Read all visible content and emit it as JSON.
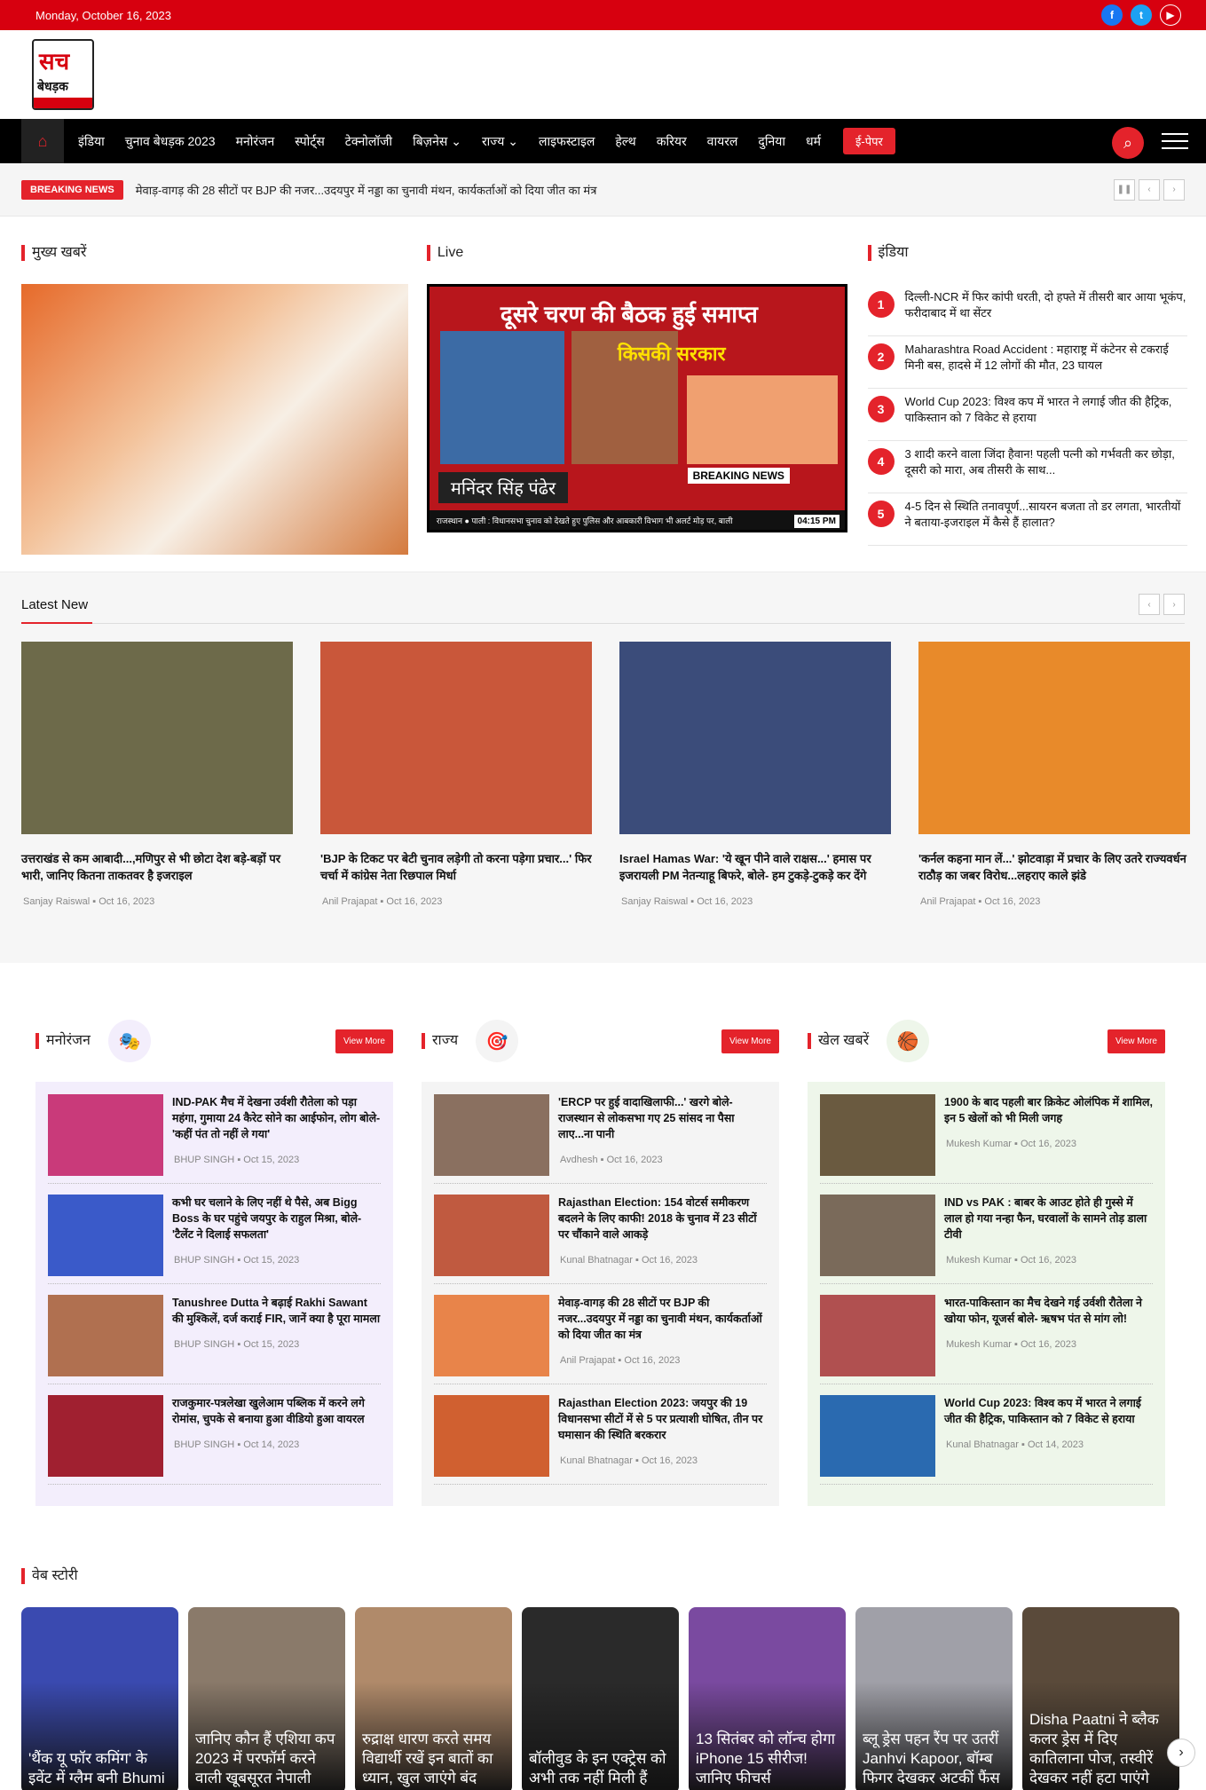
{
  "topbar": {
    "date": "Monday, October 16, 2023",
    "social": [
      "f",
      "t",
      "▶"
    ]
  },
  "logo": {
    "line1": "सच",
    "line2": "बेधड़क"
  },
  "nav": {
    "items": [
      "इंडिया",
      "चुनाव बेधड़क 2023",
      "मनोरंजन",
      "स्पोर्ट्स",
      "टेक्नोलॉजी",
      "बिज़नेस ⌄",
      "राज्य ⌄",
      "लाइफस्टाइल",
      "हेल्थ",
      "करियर",
      "वायरल",
      "दुनिया",
      "धर्म"
    ],
    "epaper": "ई-पेपर"
  },
  "breaking": {
    "label": "BREAKING NEWS",
    "text": "मेवाड़-वागड़ की 28 सीटों पर BJP की नजर...उदयपुर में नड्डा का चुनावी मंथन, कार्यकर्ताओं को दिया जीत का मंत्र"
  },
  "top": {
    "main_title": "मुख्य खबरें",
    "live_title": "Live",
    "live": {
      "headline": "दूसरे चरण की बैठक हुई समाप्त",
      "sarkar": "किसकी सरकार",
      "breaking": "BREAKING NEWS",
      "name": "मनिंदर सिंह पंढेर",
      "ticker": "राजस्थान ● पाली : विधानसभा चुनाव को देखते हुए पुलिस और आबकारी विभाग भी अलर्ट मोड़ पर, बाली",
      "time": "04:15 PM"
    },
    "india_title": "इंडिया",
    "india": [
      {
        "n": "1",
        "t": "दिल्ली-NCR में फिर कांपी धरती, दो हफ्ते में तीसरी बार आया भूकंप, फरीदाबाद में था सेंटर"
      },
      {
        "n": "2",
        "t": "Maharashtra Road Accident : महाराष्ट्र में कंटेनर से टकराई मिनी बस, हादसे में 12 लोगों की मौत, 23 घायल"
      },
      {
        "n": "3",
        "t": "World Cup 2023: विश्व कप में भारत ने लगाई जीत की हैट्रिक, पाकिस्तान को 7 विकेट से हराया"
      },
      {
        "n": "4",
        "t": "3 शादी करने वाला जिंदा हैवान! पहली पत्नी को गर्भवती कर छोड़ा, दूसरी को मारा, अब तीसरी के साथ..."
      },
      {
        "n": "5",
        "t": "4-5 दिन से स्थिति तनावपूर्ण...सायरन बजता तो डर लगता, भारतीयों ने बताया-इजराइल में कैसे हैं हालात?"
      }
    ]
  },
  "latest": {
    "title": "Latest New",
    "cards": [
      {
        "t": "उत्तराखंड से कम आबादी...,मणिपुर से भी छोटा देश बड़े-बड़ों पर भारी, जानिए कितना ताकतवर है इजराइल",
        "author": "Sanjay Raiswal",
        "date": "Oct 16, 2023",
        "color": "#6d6a4a"
      },
      {
        "t": "'BJP के टिकट पर बेटी चुनाव लड़ेगी तो करना पड़ेगा प्रचार...' फिर चर्चा में कांग्रेस नेता रिछपाल मिर्धा",
        "author": "Anil Prajapat",
        "date": "Oct 16, 2023",
        "color": "#c9573a"
      },
      {
        "t": "Israel Hamas War: 'ये खून पीने वाले राक्षस...' हमास पर इजरायली PM नेतन्याहू बिफरे, बोले- हम टुकड़े-टुकड़े कर देंगे",
        "author": "Sanjay Raiswal",
        "date": "Oct 16, 2023",
        "color": "#3b4c7a"
      },
      {
        "t": "'कर्नल कहना मान लें...' झोटवाड़ा में प्रचार के लिए उतरे राज्यवर्धन राठौड़ का जबर विरोध...लहराए काले झंडे",
        "author": "Anil Prajapat",
        "date": "Oct 16, 2023",
        "color": "#e88a2a"
      }
    ]
  },
  "cats": [
    {
      "title": "मनोरंजन",
      "icon": "🎭",
      "vm": "View More",
      "bg": "#f3eefc",
      "items": [
        {
          "t": "IND-PAK मैच में देखना उर्वशी रौतेला को पड़ा महंगा, गुमाया 24 कैरेट सोने का आईफोन, लोग बोले-'कहीं पंत तो नहीं ले गया'",
          "a": "BHUP SINGH",
          "d": "Oct 15, 2023",
          "c": "#c93a7a"
        },
        {
          "t": "कभी घर चलाने के लिए नहीं थे पैसे, अब Bigg Boss के घर पहुंचे जयपुर के राहुल मिश्रा, बोले-'टैलेंट ने दिलाई सफलता'",
          "a": "BHUP SINGH",
          "d": "Oct 15, 2023",
          "c": "#3a5ac9"
        },
        {
          "t": "Tanushree Dutta ने बढ़ाई Rakhi Sawant की मुश्किलें, दर्ज कराई FIR, जानें क्या है पूरा मामला",
          "a": "BHUP SINGH",
          "d": "Oct 15, 2023",
          "c": "#b07050"
        },
        {
          "t": "राजकुमार-पत्रलेखा खुलेआम पब्लिक में करने लगे रोमांस, चुपके से बनाया हुआ वीडियो हुआ वायरल",
          "a": "BHUP SINGH",
          "d": "Oct 14, 2023",
          "c": "#a02030"
        }
      ]
    },
    {
      "title": "राज्य",
      "icon": "🎯",
      "vm": "View More",
      "bg": "#f4f4f4",
      "items": [
        {
          "t": "'ERCP पर हुई वादाखिलाफी...' खरगे बोले-राजस्थान से लोकसभा गए 25 सांसद ना पैसा लाए...ना पानी",
          "a": "Avdhesh",
          "d": "Oct 16, 2023",
          "c": "#8a7060"
        },
        {
          "t": "Rajasthan Election: 154 वोटर्स समीकरण बदलने के लिए काफी! 2018 के चुनाव में 23 सीटों पर चौंकाने वाले आकड़े",
          "a": "Kunal Bhatnagar",
          "d": "Oct 16, 2023",
          "c": "#c05a40"
        },
        {
          "t": "मेवाड़-वागड़ की 28 सीटों पर BJP की नजर...उदयपुर में नड्डा का चुनावी मंथन, कार्यकर्ताओं को दिया जीत का मंत्र",
          "a": "Anil Prajapat",
          "d": "Oct 16, 2023",
          "c": "#e8844a"
        },
        {
          "t": "Rajasthan Election 2023: जयपुर की 19 विधानसभा सीटों में से 5 पर प्रत्याशी घोषित, तीन पर घमासान की स्थिति बरकरार",
          "a": "Kunal Bhatnagar",
          "d": "Oct 16, 2023",
          "c": "#d06030"
        }
      ]
    },
    {
      "title": "खेल खबरें",
      "icon": "🏀",
      "vm": "View More",
      "bg": "#eef6ea",
      "items": [
        {
          "t": "1900 के बाद पहली बार क्रिकेट ओलंपिक में शामिल, इन 5 खेलों को भी मिली जगह",
          "a": "Mukesh Kumar",
          "d": "Oct 16, 2023",
          "c": "#6a5a40"
        },
        {
          "t": "IND vs PAK : बाबर के आउट होते ही गुस्से में लाल हो गया नन्हा फैन, घरवालों के सामने तोड़ डाला टीवी",
          "a": "Mukesh Kumar",
          "d": "Oct 16, 2023",
          "c": "#7a6a5a"
        },
        {
          "t": "भारत-पाकिस्तान का मैच देखने गई उर्वशी रौतेला ने खोया फोन, यूजर्स बोले- ऋषभ पंत से मांग लो!",
          "a": "Mukesh Kumar",
          "d": "Oct 16, 2023",
          "c": "#b05050"
        },
        {
          "t": "World Cup 2023: विश्व कप में भारत ने लगाई जीत की हैट्रिक, पाकिस्तान को 7 विकेट से हराया",
          "a": "Kunal Bhatnagar",
          "d": "Oct 14, 2023",
          "c": "#2a6ab0"
        }
      ]
    }
  ],
  "web": {
    "title": "वेब स्टोरी",
    "stories": [
      {
        "t": "'थैंक यू फॉर कमिंग' के इवेंट में ग्लैम बनी Bhumi",
        "c": "#3a4ab0"
      },
      {
        "t": "जानिए कौन हैं एशिया कप 2023 में परफॉर्म करने वाली खूबसूरत नेपाली",
        "c": "#8a7a6a"
      },
      {
        "t": "रुद्राक्ष धारण करते समय विद्यार्थी रखें इन बातों का ध्यान, खुल जाएंगे बंद",
        "c": "#b08a6a"
      },
      {
        "t": "बॉलीवुड के इन एक्ट्रेस को अभी तक नहीं मिली हैं",
        "c": "#2a2a2a"
      },
      {
        "t": "13 सितंबर को लॉन्च होगा iPhone 15 सीरीज! जानिए फीचर्स",
        "c": "#7a4aa0"
      },
      {
        "t": "ब्लू ड्रेस पहन रैंप पर उतरीं Janhvi Kapoor, बॉम्ब फिगर देखकर अटकीं फैंस",
        "c": "#a0a0a8"
      },
      {
        "t": "Disha Paatni ने ब्लैक कलर ड्रेस में दिए कातिलाना पोज, तस्वीरें देखकर नहीं हटा पाएंगे",
        "c": "#5a4a3a"
      }
    ]
  }
}
